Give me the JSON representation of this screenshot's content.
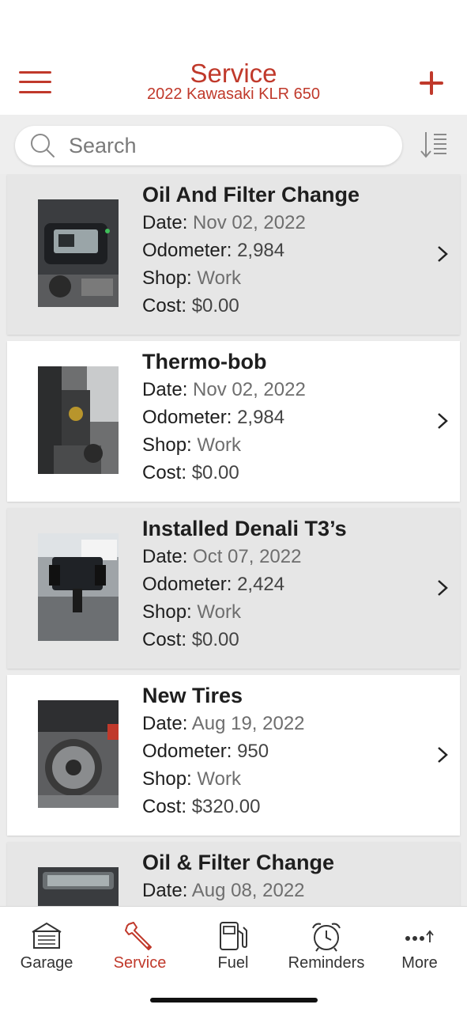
{
  "header": {
    "title": "Service",
    "subtitle": "2022 Kawasaki KLR 650"
  },
  "search": {
    "placeholder": "Search"
  },
  "records": [
    {
      "title": "Oil And Filter Change",
      "date_label": "Date:",
      "date": "Nov 02, 2022",
      "odometer_label": "Odometer:",
      "odometer": "2,984",
      "shop_label": "Shop:",
      "shop": "Work",
      "cost_label": "Cost:",
      "cost": "$0.00"
    },
    {
      "title": "Thermo-bob",
      "date_label": "Date:",
      "date": "Nov 02, 2022",
      "odometer_label": "Odometer:",
      "odometer": "2,984",
      "shop_label": "Shop:",
      "shop": "Work",
      "cost_label": "Cost:",
      "cost": "$0.00"
    },
    {
      "title": "Installed Denali T3’s",
      "date_label": "Date:",
      "date": "Oct 07, 2022",
      "odometer_label": "Odometer:",
      "odometer": "2,424",
      "shop_label": "Shop:",
      "shop": "Work",
      "cost_label": "Cost:",
      "cost": "$0.00"
    },
    {
      "title": "New Tires",
      "date_label": "Date:",
      "date": "Aug 19, 2022",
      "odometer_label": "Odometer:",
      "odometer": "950",
      "shop_label": "Shop:",
      "shop": "Work",
      "cost_label": "Cost:",
      "cost": "$320.00"
    },
    {
      "title": "Oil & Filter Change",
      "date_label": "Date:",
      "date": "Aug 08, 2022"
    }
  ],
  "tabs": [
    {
      "label": "Garage",
      "icon": "garage-icon"
    },
    {
      "label": "Service",
      "icon": "wrench-icon",
      "active": true
    },
    {
      "label": "Fuel",
      "icon": "fuel-pump-icon"
    },
    {
      "label": "Reminders",
      "icon": "alarm-clock-icon"
    },
    {
      "label": "More",
      "icon": "more-icon"
    }
  ],
  "colors": {
    "accent": "#c0392b",
    "list_background": "#ececec",
    "card_shaded": "#e6e6e6"
  }
}
